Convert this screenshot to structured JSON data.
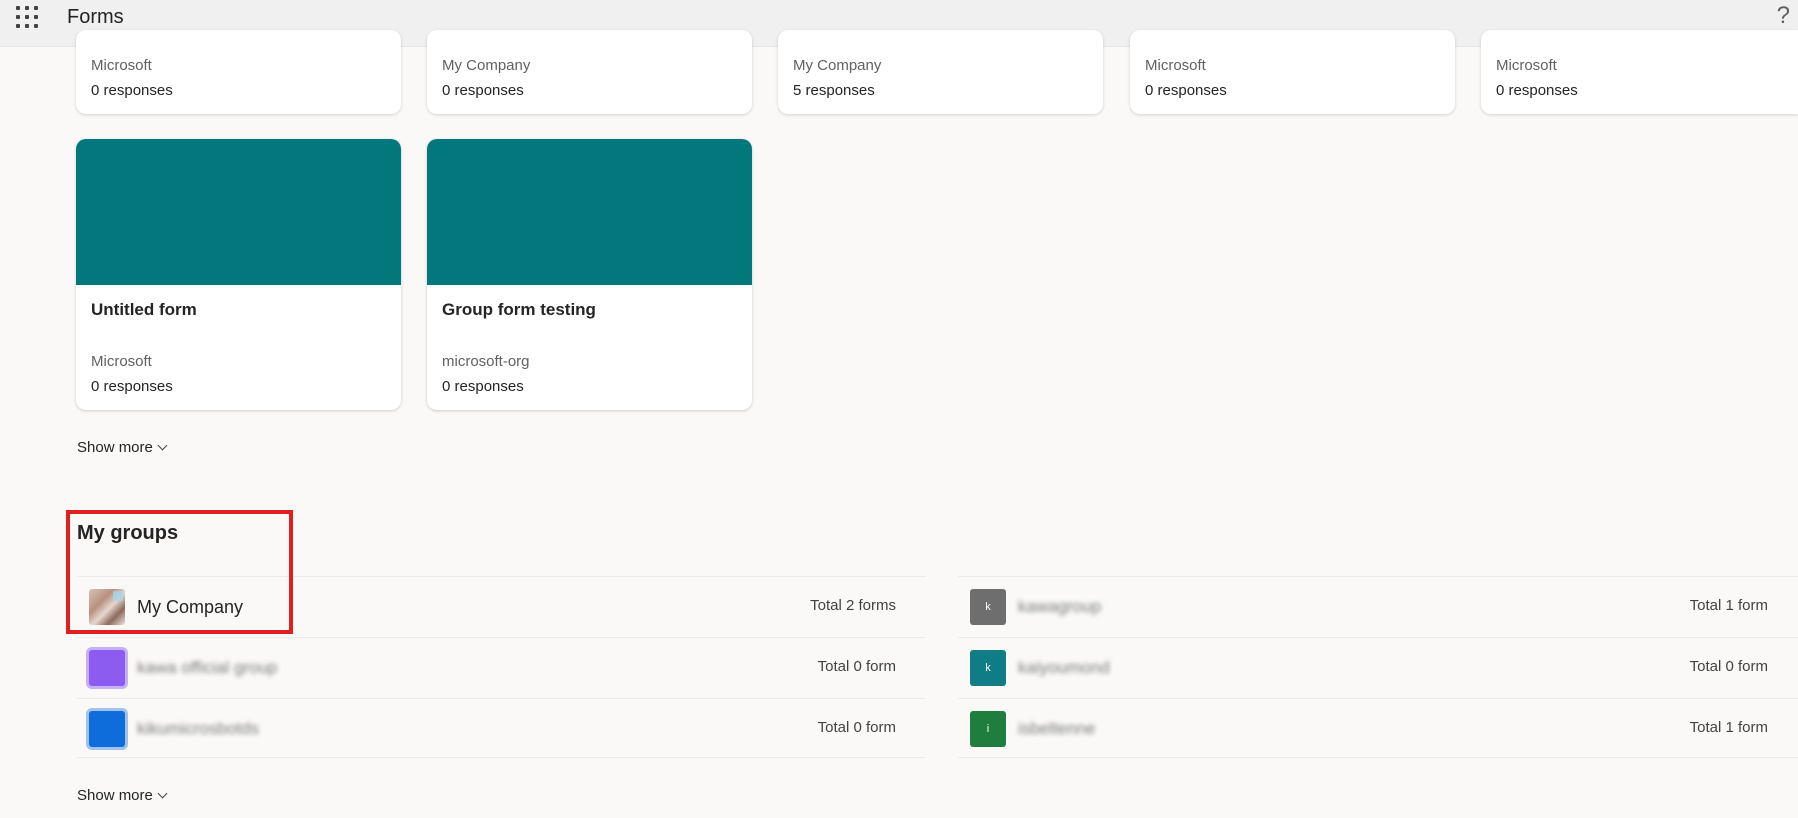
{
  "header": {
    "app_title": "Forms",
    "help_glyph": "?",
    "app_launcher_icon": "waffle-icon",
    "help_icon": "question-mark-icon"
  },
  "top_cards": [
    {
      "owner": "Microsoft",
      "responses": "0 responses"
    },
    {
      "owner": "My Company",
      "responses": "0 responses"
    },
    {
      "owner": "My Company",
      "responses": "5 responses"
    },
    {
      "owner": "Microsoft",
      "responses": "0 responses"
    },
    {
      "owner": "Microsoft",
      "responses": "0 responses"
    }
  ],
  "cards": [
    {
      "title": "Untitled form",
      "owner": "Microsoft",
      "responses": "0 responses",
      "banner_color": "#03787c"
    },
    {
      "title": "Group form testing",
      "owner": "microsoft-org",
      "responses": "0 responses",
      "banner_color": "#03787c"
    }
  ],
  "forms_show_more": "Show more",
  "groups": {
    "title": "My groups",
    "show_more": "Show more",
    "left": [
      {
        "name": "My Company",
        "count": "Total 2 forms"
      },
      {
        "name": "kawa official group",
        "count": "Total 0 form"
      },
      {
        "name": "kikumicrosbotds",
        "count": "Total 0 form"
      }
    ],
    "right": [
      {
        "avatar_letter": "k",
        "name": "kawagroup",
        "count": "Total 1 form"
      },
      {
        "avatar_letter": "k",
        "name": "kaiyoumond",
        "count": "Total 0 form"
      },
      {
        "avatar_letter": "i",
        "name": "isbeltenne",
        "count": "Total 1 form"
      }
    ]
  },
  "colors": {
    "banner": "#03787c",
    "highlight": "#e21f1f",
    "background": "#faf9f8"
  }
}
